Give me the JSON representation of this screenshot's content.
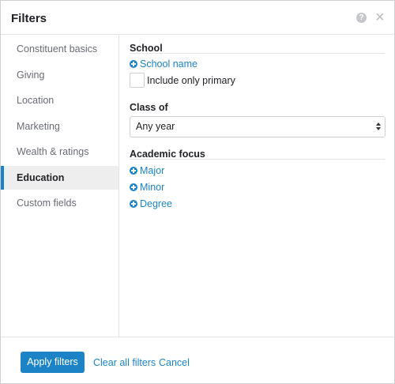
{
  "header": {
    "title": "Filters",
    "help_icon_glyph": "?",
    "close_icon_glyph": "×"
  },
  "sidebar": {
    "items": [
      {
        "label": "Constituent basics",
        "active": false
      },
      {
        "label": "Giving",
        "active": false
      },
      {
        "label": "Location",
        "active": false
      },
      {
        "label": "Marketing",
        "active": false
      },
      {
        "label": "Wealth & ratings",
        "active": false
      },
      {
        "label": "Education",
        "active": true
      },
      {
        "label": "Custom fields",
        "active": false
      }
    ]
  },
  "main": {
    "school": {
      "title": "School",
      "add_link": "School name",
      "checkbox_label": "Include only primary",
      "checkbox_checked": false
    },
    "class_of": {
      "title": "Class of",
      "selected": "Any year"
    },
    "academic_focus": {
      "title": "Academic focus",
      "links": [
        "Major",
        "Minor",
        "Degree"
      ]
    }
  },
  "footer": {
    "apply_label": "Apply filters",
    "clear_label": "Clear all filters",
    "cancel_label": "Cancel"
  },
  "colors": {
    "accent": "#1c84c6",
    "active_bg": "#eeeeef",
    "border": "#e2e3e4",
    "muted_text": "#686c73"
  },
  "icons": {
    "help": "question-circle-icon",
    "close": "close-icon",
    "add": "plus-circle-icon",
    "select": "up-down-arrows-icon"
  }
}
